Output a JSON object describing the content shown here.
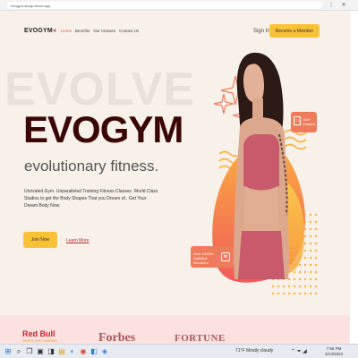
{
  "browser": {
    "url": "evogym-study.vercel.app",
    "menu_glyph": "⋮",
    "close_glyph": "✕"
  },
  "navbar": {
    "logo": "EVOGYM",
    "links": [
      "Home",
      "Benefits",
      "Our Classes",
      "Contact Us"
    ],
    "signin": "Sign In",
    "member_button": "Become a Member"
  },
  "hero": {
    "background_word": "EVOLVE",
    "title": "EVOGYM",
    "subtitle": "evolutionary fitness.",
    "description": "Unrivaled Gym. Unparalleled Training Fitness Classes. World Class Studios to get the Body Shapes That you Dream of.. Get Your Dream Body Now.",
    "join_button": "Join Now",
    "learn_link": "Learn More",
    "callout_top": "100+ Classes",
    "callout_bottom": "Over 10000+ Satisfied Members"
  },
  "sponsors": {
    "redbull": "Red Bull",
    "redbull_sub": "GIVES YOU WIIINGS",
    "forbes": "Forbes",
    "fortune": "FORTUNE"
  },
  "taskbar": {
    "weather": "71°F Mostly cloudy",
    "time": "7:55 PM",
    "date": "3/13/2023"
  },
  "colors": {
    "accent": "#f9c236",
    "brand_dark": "#3a0606",
    "coral": "#f07b5a",
    "page_bg": "#f8f1e9",
    "sponsor_bg": "#fde1e1"
  },
  "icons": [
    "windows-icon",
    "search-icon",
    "task-view-icon",
    "explorer-icon",
    "edge-icon",
    "chrome-icon",
    "vscode-icon"
  ]
}
